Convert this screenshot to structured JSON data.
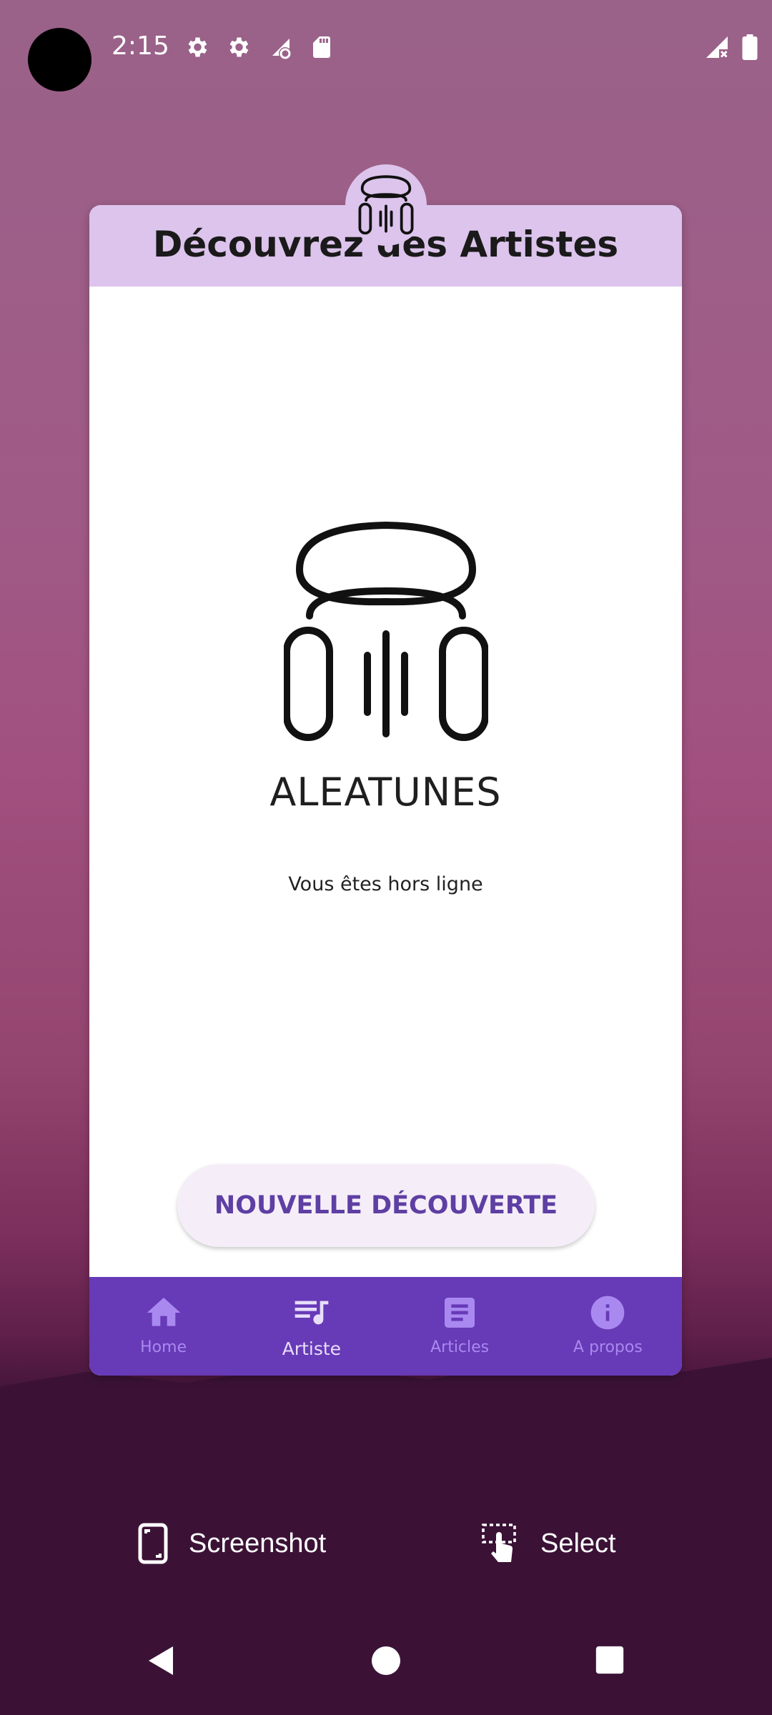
{
  "status_bar": {
    "time": "2:15",
    "icons": [
      "settings-icon",
      "settings-icon",
      "wifi-settings-icon",
      "sd-card-icon"
    ],
    "right_icons": [
      "no-signal-icon",
      "battery-icon"
    ]
  },
  "card": {
    "title": "Découvrez des Artistes",
    "brand": "ALEATUNES",
    "status_message": "Vous êtes hors ligne",
    "discover_button": "NOUVELLE DÉCOUVERTE"
  },
  "bottom_nav": {
    "items": [
      {
        "label": "Home",
        "icon": "home-icon"
      },
      {
        "label": "Artiste",
        "icon": "playlist-music-icon"
      },
      {
        "label": "Articles",
        "icon": "article-icon"
      },
      {
        "label": "A propos",
        "icon": "info-icon"
      }
    ],
    "active": "Artiste"
  },
  "overlay_actions": {
    "screenshot": "Screenshot",
    "select": "Select"
  },
  "colors": {
    "nav_bg": "#673ab7",
    "header_bg": "#dcc4ec",
    "button_text": "#5e3fa3",
    "nav_inactive": "#a989f0"
  }
}
